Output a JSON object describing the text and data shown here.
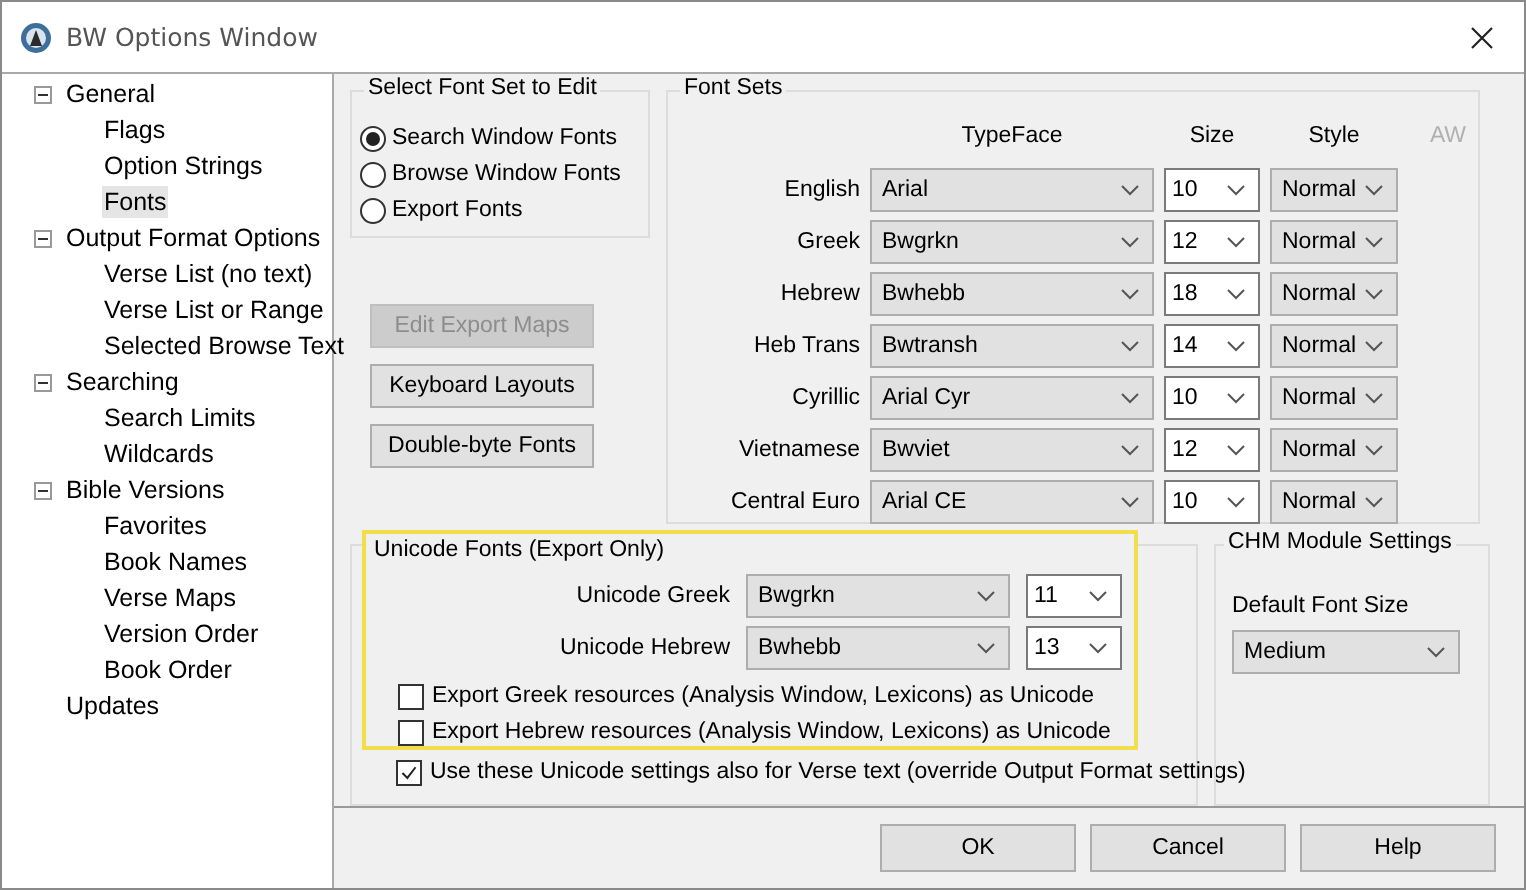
{
  "window": {
    "title": "BW Options Window"
  },
  "tree": [
    {
      "label": "General",
      "expanded": true,
      "selected": false,
      "children": [
        {
          "label": "Flags",
          "selected": false
        },
        {
          "label": "Option Strings",
          "selected": false
        },
        {
          "label": "Fonts",
          "selected": true
        }
      ]
    },
    {
      "label": "Output Format Options",
      "expanded": true,
      "selected": false,
      "children": [
        {
          "label": "Verse List (no text)",
          "selected": false
        },
        {
          "label": "Verse List or Range",
          "selected": false
        },
        {
          "label": "Selected Browse Text",
          "selected": false
        }
      ]
    },
    {
      "label": "Searching",
      "expanded": true,
      "selected": false,
      "children": [
        {
          "label": "Search Limits",
          "selected": false
        },
        {
          "label": "Wildcards",
          "selected": false
        }
      ]
    },
    {
      "label": "Bible Versions",
      "expanded": true,
      "selected": false,
      "children": [
        {
          "label": "Favorites",
          "selected": false
        },
        {
          "label": "Book Names",
          "selected": false
        },
        {
          "label": "Verse Maps",
          "selected": false
        },
        {
          "label": "Version Order",
          "selected": false
        },
        {
          "label": "Book Order",
          "selected": false
        }
      ]
    },
    {
      "label": "Updates",
      "selected": false
    }
  ],
  "font_set_select": {
    "title": "Select Font Set to Edit",
    "options": [
      {
        "label": "Search Window Fonts",
        "selected": true
      },
      {
        "label": "Browse Window Fonts",
        "selected": false
      },
      {
        "label": "Export Fonts",
        "selected": false
      }
    ]
  },
  "side_buttons": [
    {
      "label": "Edit Export Maps",
      "disabled": true
    },
    {
      "label": "Keyboard Layouts",
      "disabled": false
    },
    {
      "label": "Double-byte Fonts",
      "disabled": false
    }
  ],
  "font_sets": {
    "title": "Font Sets",
    "columns": [
      {
        "label": "TypeFace",
        "disabled": false
      },
      {
        "label": "Size",
        "disabled": false
      },
      {
        "label": "Style",
        "disabled": false
      },
      {
        "label": "AW",
        "disabled": true
      }
    ],
    "rows": [
      {
        "label": "English",
        "typeface": "Arial",
        "size": "10",
        "style": "Normal"
      },
      {
        "label": "Greek",
        "typeface": "Bwgrkn",
        "size": "12",
        "style": "Normal"
      },
      {
        "label": "Hebrew",
        "typeface": "Bwhebb",
        "size": "18",
        "style": "Normal"
      },
      {
        "label": "Heb Trans",
        "typeface": "Bwtransh",
        "size": "14",
        "style": "Normal"
      },
      {
        "label": "Cyrillic",
        "typeface": "Arial Cyr",
        "size": "10",
        "style": "Normal"
      },
      {
        "label": "Vietnamese",
        "typeface": "Bwviet",
        "size": "12",
        "style": "Normal"
      },
      {
        "label": "Central Euro",
        "typeface": "Arial CE",
        "size": "10",
        "style": "Normal"
      }
    ]
  },
  "unicode_fonts": {
    "title": "Unicode Fonts (Export Only)",
    "rows": [
      {
        "label": "Unicode Greek",
        "typeface": "Bwgrkn",
        "size": "11"
      },
      {
        "label": "Unicode Hebrew",
        "typeface": "Bwhebb",
        "size": "13"
      }
    ],
    "checkboxes": [
      {
        "label": "Export Greek resources (Analysis Window, Lexicons) as Unicode",
        "checked": false
      },
      {
        "label": "Export Hebrew resources (Analysis Window, Lexicons) as Unicode",
        "checked": false
      }
    ]
  },
  "verse_text_checkbox": {
    "label": "Use these Unicode settings also for Verse text (override Output Format settings)",
    "checked": true
  },
  "chm": {
    "title": "CHM Module Settings",
    "field_label": "Default Font Size",
    "value": "Medium"
  },
  "buttons": [
    "OK",
    "Cancel",
    "Help"
  ]
}
